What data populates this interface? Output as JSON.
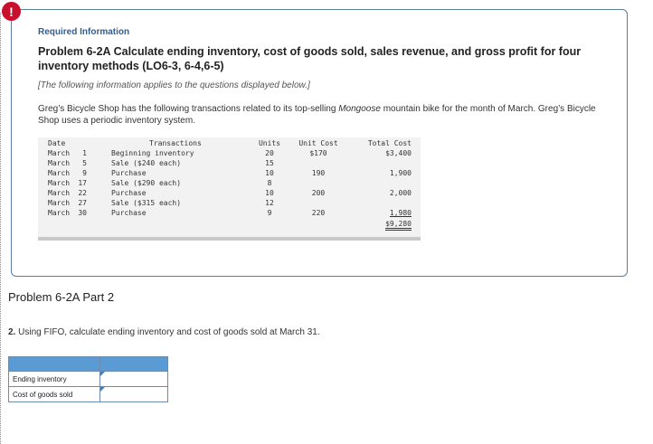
{
  "badge": "!",
  "info": {
    "required_label": "Required Information",
    "problem_title": "Problem 6-2A Calculate ending inventory, cost of goods sold, sales revenue, and gross profit for four inventory methods (LO6-3, 6-4,6-5)",
    "applies_note": "[The following information applies to the questions displayed below.]",
    "description_before": "Greg’s Bicycle Shop has the following transactions related to its top-selling ",
    "description_em": "Mongoose",
    "description_after": " mountain bike for the month of March. Greg’s Bicycle Shop uses a periodic inventory system."
  },
  "transactions": {
    "headers": {
      "date": "Date",
      "transactions": "Transactions",
      "units": "Units",
      "unit_cost": "Unit Cost",
      "total_cost": "Total Cost"
    },
    "rows": [
      {
        "month": "March",
        "day": "1",
        "description": "Beginning inventory",
        "units": "20",
        "unit_cost": "$170",
        "total_cost": "$3,400"
      },
      {
        "month": "March",
        "day": "5",
        "description": "Sale ($240 each)",
        "units": "15",
        "unit_cost": "",
        "total_cost": ""
      },
      {
        "month": "March",
        "day": "9",
        "description": "Purchase",
        "units": "10",
        "unit_cost": "190",
        "total_cost": "1,900"
      },
      {
        "month": "March",
        "day": "17",
        "description": "Sale ($290 each)",
        "units": "8",
        "unit_cost": "",
        "total_cost": ""
      },
      {
        "month": "March",
        "day": "22",
        "description": "Purchase",
        "units": "10",
        "unit_cost": "200",
        "total_cost": "2,000"
      },
      {
        "month": "March",
        "day": "27",
        "description": "Sale ($315 each)",
        "units": "12",
        "unit_cost": "",
        "total_cost": ""
      },
      {
        "month": "March",
        "day": "30",
        "description": "Purchase",
        "units": "9",
        "unit_cost": "220",
        "total_cost": "1,980"
      }
    ],
    "grand_total": "$9,280"
  },
  "part": {
    "title": "Problem 6-2A Part 2",
    "question_number": "2.",
    "question_text": " Using FIFO, calculate ending inventory and cost of goods sold at March 31."
  },
  "answer_table": {
    "rows": [
      {
        "label": "Ending inventory",
        "value": ""
      },
      {
        "label": "Cost of goods sold",
        "value": ""
      }
    ]
  }
}
